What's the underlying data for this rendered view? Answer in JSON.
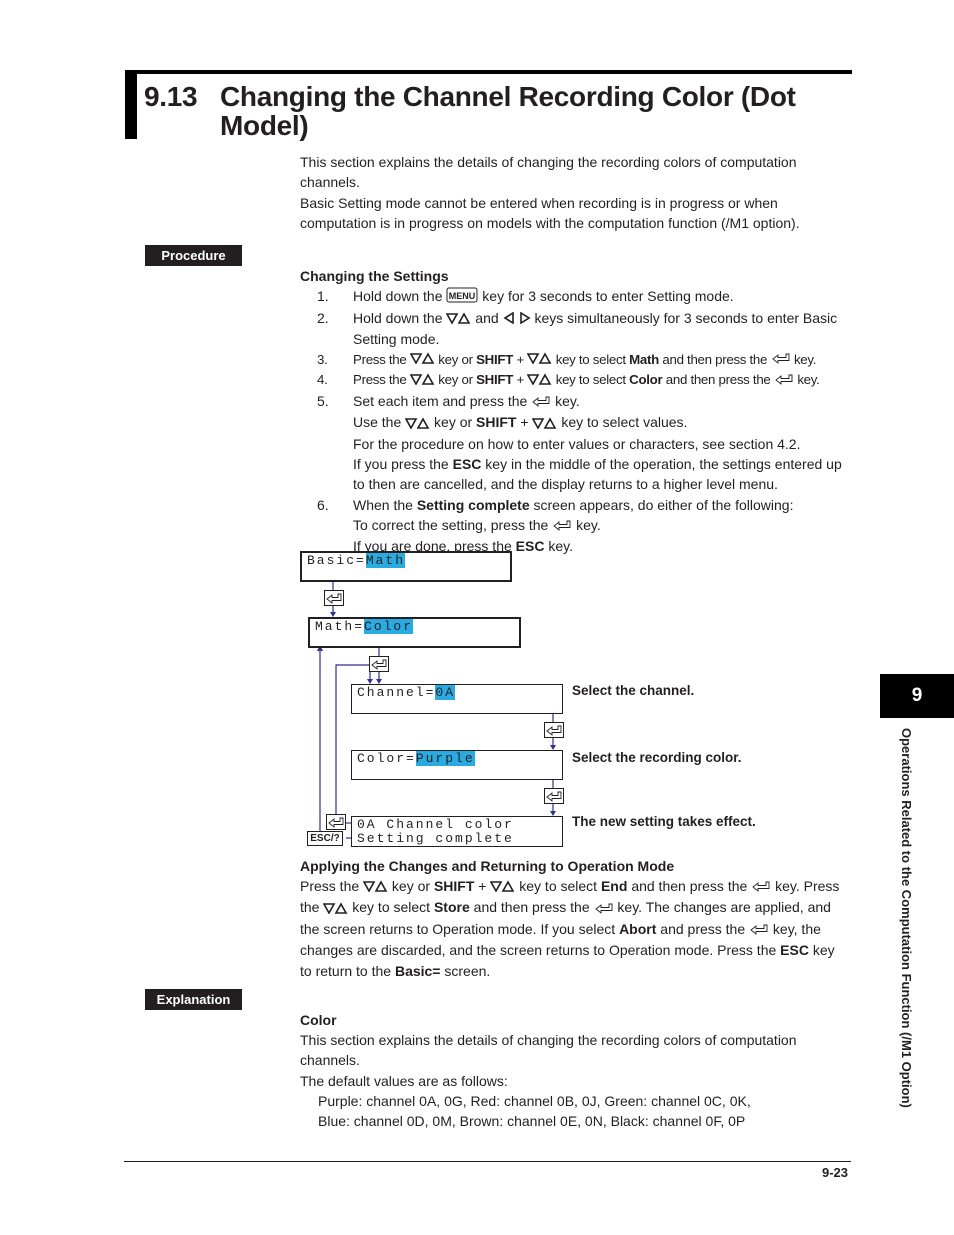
{
  "header": {
    "section_number": "9.13",
    "title_line1": "Changing the Channel Recording Color (Dot",
    "title_line2": "Model)"
  },
  "intro": {
    "line1": "This section explains the details of changing the recording colors of computation",
    "line2": "channels.",
    "line3": "Basic Setting mode cannot be entered when recording is in progress or when",
    "line4": "computation is in progress on models with the computation function (/M1 option)."
  },
  "procedure": {
    "label": "Procedure",
    "heading": "Changing the Settings",
    "steps": [
      {
        "n": "1.",
        "a": "Hold down the",
        "key": "MENU",
        "b": "key for 3 seconds to enter Setting mode."
      },
      {
        "n": "2.",
        "a": "Hold down the",
        "b": "and",
        "c": "keys simultaneously for 3 seconds to enter Basic",
        "d": "Setting mode."
      },
      {
        "n": "3.",
        "a": "Press the",
        "b": "key or",
        "shift": "SHIFT",
        "plus": "+",
        "c": "key to select",
        "target": "Math",
        "d": "and then press the",
        "e": "key."
      },
      {
        "n": "4.",
        "a": "Press the",
        "b": "key or",
        "shift": "SHIFT",
        "plus": "+",
        "c": "key to select",
        "target": "Color",
        "d": "and then press the",
        "e": "key."
      },
      {
        "n": "5.",
        "a": "Set each item and press the",
        "b": "key.",
        "c": "Use the",
        "d": "key or",
        "shift": "SHIFT",
        "plus": "+",
        "e": "key to select values.",
        "f": "For the procedure on how to enter values or characters, see section 4.2.",
        "g": "If you press the",
        "esc": "ESC",
        "h": "key in the middle of the operation, the settings entered up",
        "i": "to then are cancelled, and the display returns to a higher level menu."
      },
      {
        "n": "6.",
        "a": "When the",
        "bold": "Setting complete",
        "b": "screen appears, do either of the following:",
        "c": "To correct the setting, press the",
        "d": "key.",
        "e": "If you are done, press the",
        "esc": "ESC",
        "f": "key."
      }
    ]
  },
  "diagram": {
    "screens": [
      {
        "label": "Basic=",
        "value": "Math"
      },
      {
        "label": "Math=",
        "value": "Color"
      },
      {
        "label": "Channel=",
        "value": "0A",
        "desc": "Select the channel."
      },
      {
        "label": "Color=",
        "value": "Purple",
        "desc": "Select the recording color."
      },
      {
        "line1": "0A Channel color",
        "line2": "Setting complete",
        "desc": "The new setting takes effect."
      }
    ],
    "esc_key": "ESC/?"
  },
  "applying": {
    "heading": "Applying the Changes and Returning to Operation Mode",
    "l1": {
      "a": "Press the",
      "b": "key or",
      "shift": "SHIFT",
      "plus": "+",
      "c": "key to select",
      "end": "End",
      "d": "and then press the",
      "e": "key.  Press"
    },
    "l2": {
      "a": "the",
      "b": "key to select",
      "store": "Store",
      "c": "and then press the",
      "d": "key.  The changes are applied, and"
    },
    "l3": {
      "a": "the screen returns to Operation mode.  If you select",
      "abort": "Abort",
      "b": "and press the",
      "c": "key, the"
    },
    "l4": {
      "a": "changes are discarded, and the screen returns to Operation mode.  Press the",
      "esc": "ESC",
      "b": "key"
    },
    "l5": {
      "a": "to return to the",
      "basic": "Basic=",
      "b": "screen."
    }
  },
  "explanation": {
    "label": "Explanation",
    "heading": "Color",
    "l1": "This section explains the details of changing the recording colors of computation",
    "l2": "channels.",
    "l3": "The default values are as follows:",
    "l4": "Purple: channel 0A, 0G, Red: channel 0B, 0J, Green: channel 0C, 0K,",
    "l5": "Blue: channel 0D, 0M, Brown: channel 0E, 0N, Black: channel 0F, 0P"
  },
  "side_tab": {
    "number": "9",
    "text": "Operations Related to the Computation Function (/M1 Option)"
  },
  "footer": {
    "page": "9-23"
  },
  "colors": {
    "highlight": "#29abe2",
    "connector": "#2e3192"
  }
}
